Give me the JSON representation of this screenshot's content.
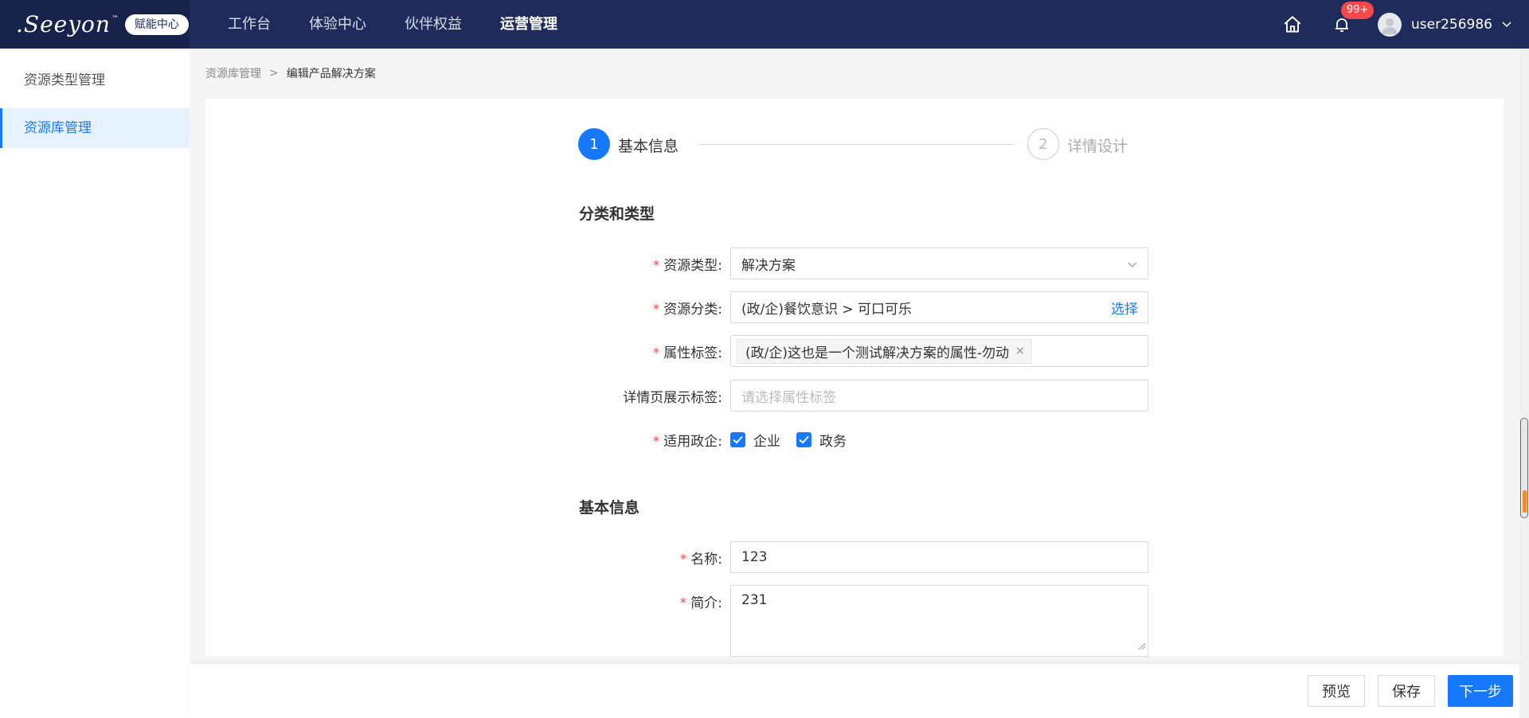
{
  "header": {
    "logo_text": ".Seeyon",
    "logo_tm": "™",
    "logo_badge": "赋能中心",
    "nav": [
      "工作台",
      "体验中心",
      "伙伴权益",
      "运营管理"
    ],
    "notification_count": "99+",
    "username": "user256986"
  },
  "sidebar": {
    "items": [
      {
        "label": "资源类型管理"
      },
      {
        "label": "资源库管理"
      }
    ]
  },
  "breadcrumb": {
    "parent": "资源库管理",
    "separator": ">",
    "current": "编辑产品解决方案"
  },
  "steps": [
    {
      "number": "1",
      "label": "基本信息"
    },
    {
      "number": "2",
      "label": "详情设计"
    }
  ],
  "sections": {
    "category": "分类和类型",
    "basic": "基本信息"
  },
  "form": {
    "resource_type": {
      "label": "资源类型:",
      "value": "解决方案"
    },
    "resource_category": {
      "label": "资源分类:",
      "value": "(政/企)餐饮意识 > 可口可乐",
      "action": "选择"
    },
    "attribute_tags": {
      "label": "属性标签:",
      "tag": "(政/企)这也是一个测试解决方案的属性-勿动",
      "tag_close": "×"
    },
    "detail_tags": {
      "label": "详情页展示标签:",
      "placeholder": "请选择属性标签"
    },
    "applicable": {
      "label": "适用政企:",
      "options": [
        "企业",
        "政务"
      ]
    },
    "name": {
      "label": "名称:",
      "value": "123"
    },
    "intro": {
      "label": "简介:",
      "value": "231"
    }
  },
  "footer": {
    "preview": "预览",
    "save": "保存",
    "next": "下一步"
  },
  "colors": {
    "topbar": "#1f2b5b",
    "primary": "#1677ff",
    "required": "#f5484c"
  }
}
